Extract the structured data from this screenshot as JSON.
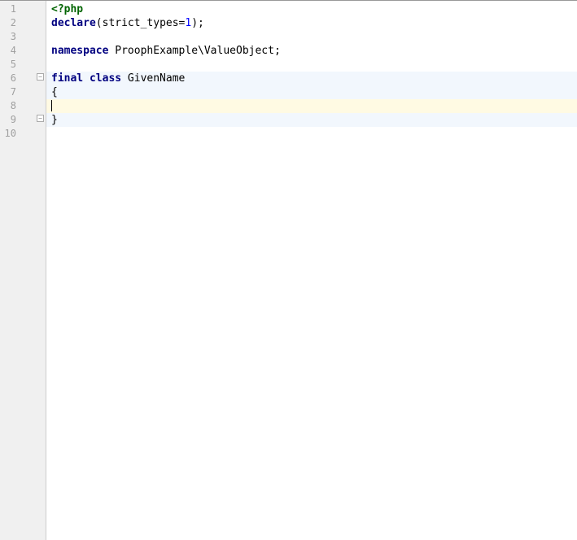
{
  "editor": {
    "gutter": {
      "start": 1,
      "end": 10
    },
    "fold_markers": [
      {
        "line": 6,
        "symbol": "−"
      },
      {
        "line": 9,
        "symbol": "−"
      }
    ],
    "current_line": 8,
    "highlight_start": 6,
    "highlight_end": 9,
    "lines": [
      {
        "n": 1,
        "tokens": [
          {
            "cls": "kw-tag",
            "t": "<?php"
          }
        ]
      },
      {
        "n": 2,
        "tokens": [
          {
            "cls": "kw",
            "t": "declare"
          },
          {
            "cls": "default",
            "t": "(strict_types="
          },
          {
            "cls": "num",
            "t": "1"
          },
          {
            "cls": "default",
            "t": ");"
          }
        ]
      },
      {
        "n": 3,
        "tokens": []
      },
      {
        "n": 4,
        "tokens": [
          {
            "cls": "kw",
            "t": "namespace "
          },
          {
            "cls": "default",
            "t": "ProophExample\\ValueObject;"
          }
        ]
      },
      {
        "n": 5,
        "tokens": []
      },
      {
        "n": 6,
        "tokens": [
          {
            "cls": "kw",
            "t": "final class "
          },
          {
            "cls": "default",
            "t": "GivenName"
          }
        ]
      },
      {
        "n": 7,
        "tokens": [
          {
            "cls": "default",
            "t": "{"
          }
        ]
      },
      {
        "n": 8,
        "tokens": [],
        "cursor": true
      },
      {
        "n": 9,
        "tokens": [
          {
            "cls": "default",
            "t": "}"
          }
        ]
      },
      {
        "n": 10,
        "tokens": []
      }
    ]
  }
}
